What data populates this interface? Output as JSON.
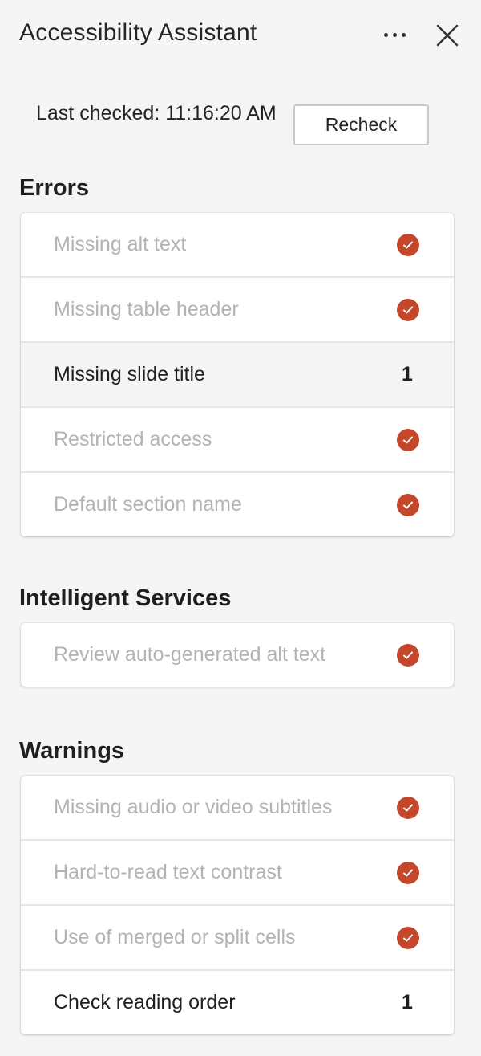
{
  "header": {
    "title": "Accessibility Assistant",
    "more_icon": "more-horizontal-icon",
    "close_icon": "close-icon"
  },
  "status": {
    "last_checked": "Last checked: 11:16:20 AM",
    "recheck_label": "Recheck"
  },
  "colors": {
    "check_badge": "#c4472b",
    "passed_text": "#b3b3b3",
    "issue_text": "#1f1f1f"
  },
  "sections": {
    "errors": {
      "title": "Errors",
      "items": [
        {
          "label": "Missing alt text",
          "status": "passed"
        },
        {
          "label": "Missing table header",
          "status": "passed"
        },
        {
          "label": "Missing slide title",
          "status": "issue",
          "count": "1"
        },
        {
          "label": "Restricted access",
          "status": "passed"
        },
        {
          "label": "Default section name",
          "status": "passed"
        }
      ]
    },
    "intelligent_services": {
      "title": "Intelligent Services",
      "items": [
        {
          "label": "Review auto-generated alt text",
          "status": "passed"
        }
      ]
    },
    "warnings": {
      "title": "Warnings",
      "items": [
        {
          "label": "Missing audio or video subtitles",
          "status": "passed"
        },
        {
          "label": "Hard-to-read text contrast",
          "status": "passed"
        },
        {
          "label": "Use of merged or split cells",
          "status": "passed"
        },
        {
          "label": "Check reading order",
          "status": "issue",
          "count": "1"
        }
      ]
    }
  }
}
